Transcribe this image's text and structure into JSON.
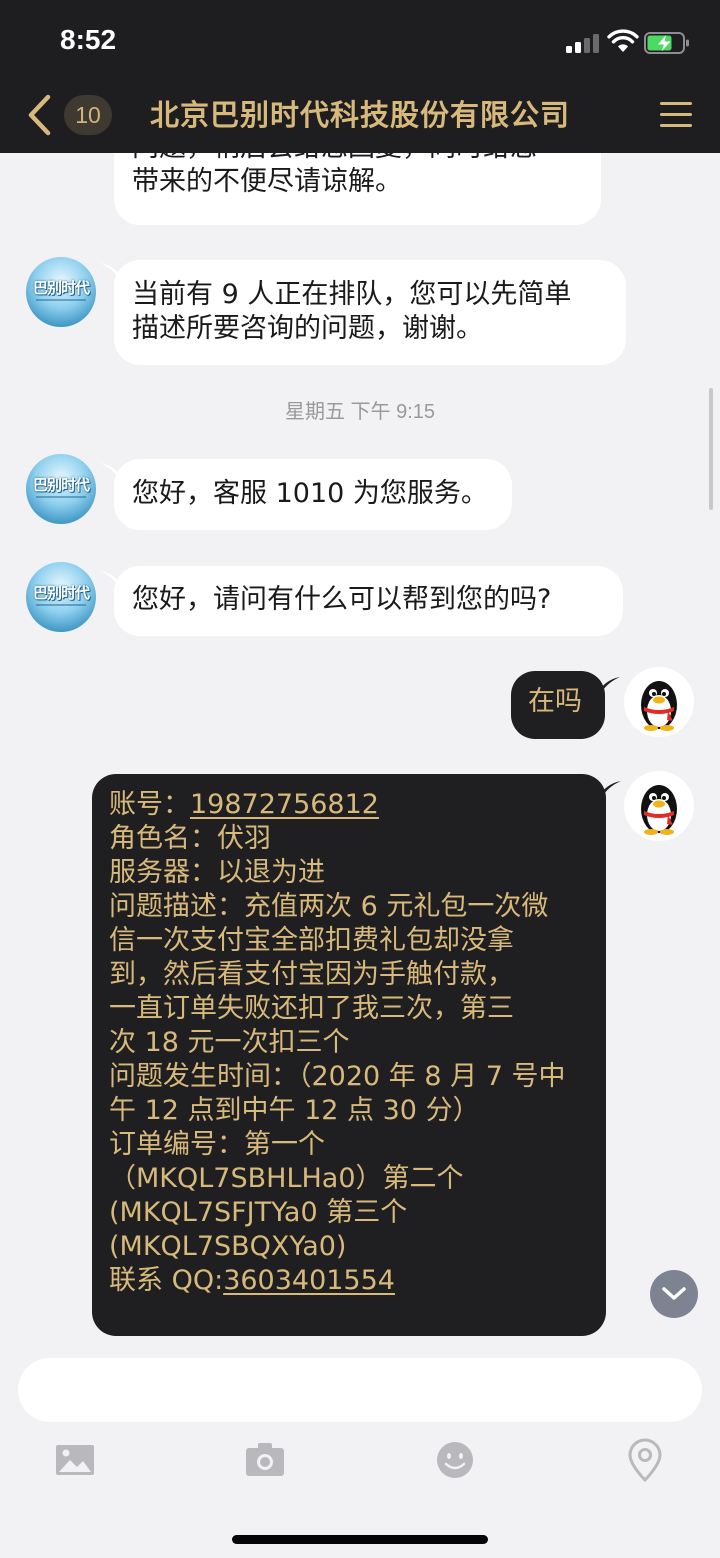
{
  "status_bar": {
    "time": "8:52"
  },
  "header": {
    "back_icon": "chevron-left-icon",
    "unread_count": "10",
    "title": "北京巴别时代科技股份有限公司",
    "menu_icon": "hamburger-menu-icon"
  },
  "colors": {
    "accent_gold": "#d8b97c",
    "dark_bar": "#1e1e20",
    "incoming_bubble": "#ffffff",
    "outgoing_bubble": "#1f1f21",
    "chat_bg": "#f2f2f4"
  },
  "messages": {
    "m1": {
      "line1": "问题，稍后会给您回复，同时给您",
      "line2": "带来的不便尽请谅解。"
    },
    "m2": {
      "line1": "当前有 9 人正在排队，您可以先简单",
      "line2": "描述所要咨询的问题，谢谢。"
    },
    "timestamp": "星期五 下午 9:15",
    "m3": "您好，客服 1010 为您服务。",
    "m4": "您好，请问有什么可以帮到您的吗?",
    "m5": "在吗",
    "company_avatar_text": "巴别时代",
    "detail": {
      "account_label": "账号：",
      "account_value": "19872756812",
      "role_line": "角色名：伏羽",
      "server_line": "服务器：以退为进",
      "desc_lines": [
        "问题描述：充值两次 6 元礼包一次微",
        "信一次支付宝全部扣费礼包却没拿",
        "到，然后看支付宝因为手触付款，",
        "一直订单失败还扣了我三次，第三",
        "次 18 元一次扣三个"
      ],
      "time_lines": [
        "问题发生时间：（2020 年 8 月 7 号中",
        "午 12 点到中午 12 点 30 分）"
      ],
      "order_lines": [
        "订单编号：第一个",
        "（MKQL7SBHLHa0）第二个",
        "(MKQL7SFJTYa0 第三个",
        "(MKQL7SBQXYa0)"
      ],
      "qq_label": "联系 QQ:",
      "qq_value": "3603401554"
    }
  },
  "input": {
    "placeholder": "",
    "value": ""
  },
  "toolbar": {
    "icons": [
      "image-icon",
      "camera-icon",
      "emoji-icon",
      "location-icon"
    ]
  }
}
